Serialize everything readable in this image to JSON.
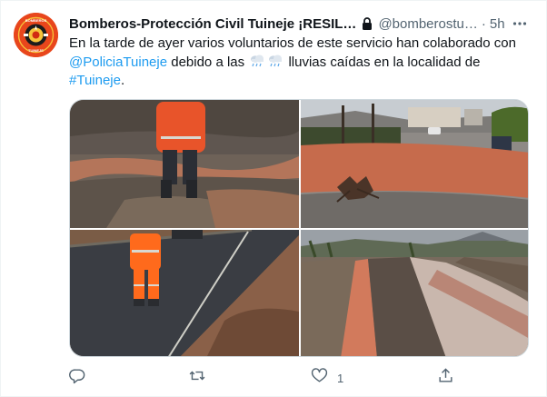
{
  "tweet": {
    "author": {
      "name": "Bomberos-Protección Civil Tuineje ¡RESIL…",
      "handle": "@bomberostu…",
      "protected_icon": "lock-icon",
      "avatar_icon": "fire-department-badge-icon",
      "avatar_texts": {
        "top": "BOMBEROS",
        "bottom": "TUINEJE"
      }
    },
    "separator": "·",
    "time": "5h",
    "more_icon": "more-dots-icon",
    "text": {
      "line1": "En la tarde de ayer varios voluntarios de este servicio han colaborado con",
      "mention": "@PoliciaTuineje",
      "line2_mid": " debido a las ",
      "emoji": "cloud-with-rain-icon",
      "line2_end": " lluvias caídas en la localidad de",
      "hashtag": "#Tuineje",
      "line3_end": "."
    },
    "media": [
      {
        "icon": "photo-volunteer-muddy-creek"
      },
      {
        "icon": "photo-flooded-street-debris"
      },
      {
        "icon": "photo-volunteer-on-road"
      },
      {
        "icon": "photo-muddy-water-channel"
      }
    ],
    "actions": {
      "reply": {
        "icon": "reply-icon",
        "count": ""
      },
      "retweet": {
        "icon": "retweet-icon",
        "count": ""
      },
      "like": {
        "icon": "heart-icon",
        "count": "1"
      },
      "share": {
        "icon": "share-icon",
        "count": ""
      }
    },
    "colors": {
      "link": "#1d9bf0",
      "secondary_text": "#536471",
      "primary_text": "#0f1419",
      "border": "#cfd9de",
      "avatar_bg": "#e8461c"
    }
  }
}
